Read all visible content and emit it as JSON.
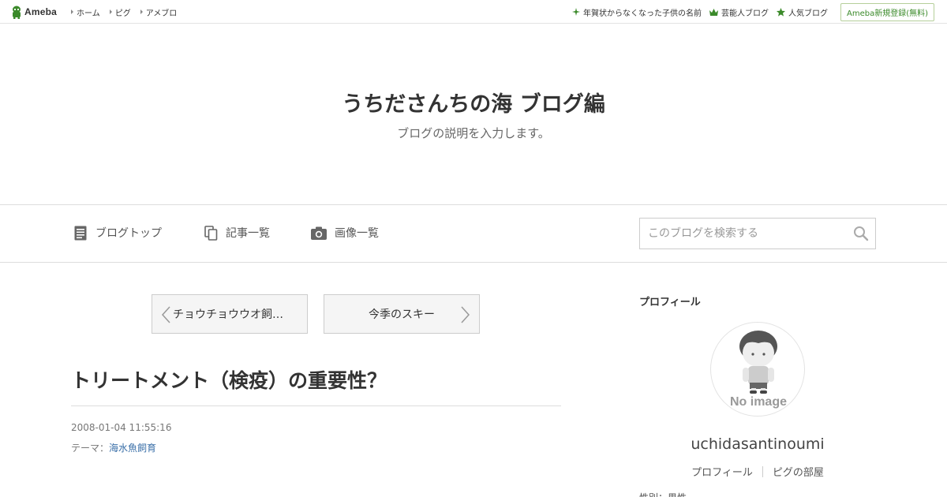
{
  "topbar": {
    "logo_text": "Ameba",
    "nav": [
      {
        "label": "ホーム"
      },
      {
        "label": "ピグ"
      },
      {
        "label": "アメブロ"
      }
    ],
    "right": [
      {
        "label": "年賀状からなくなった子供の名前",
        "icon": "sparkle-icon"
      },
      {
        "label": "芸能人ブログ",
        "icon": "crown-icon"
      },
      {
        "label": "人気ブログ",
        "icon": "star-icon"
      }
    ],
    "register_label": "Ameba新規登録(無料)",
    "accent_color": "#3b8a2a"
  },
  "header": {
    "title": "うちださんちの海 ブログ編",
    "description": "ブログの説明を入力します。"
  },
  "navbar": {
    "items": [
      {
        "label": "ブログトップ",
        "icon": "document-icon"
      },
      {
        "label": "記事一覧",
        "icon": "copy-icon"
      },
      {
        "label": "画像一覧",
        "icon": "camera-icon"
      }
    ],
    "search_placeholder": "このブログを検索する"
  },
  "pager": {
    "prev_label": "チョウチョウウオ飼…",
    "next_label": "今季のスキー"
  },
  "article": {
    "title": "トリートメント（検疫）の重要性？",
    "date": "2008-01-04 11:55:16",
    "theme_prefix": "テーマ：",
    "theme_link": "海水魚飼育",
    "link_color": "#3a6fa8"
  },
  "sidebar": {
    "heading": "プロフィール",
    "avatar_caption": "No image",
    "username": "uchidasantinoumi",
    "links": [
      "プロフィール",
      "ピグの部屋"
    ],
    "cut_text": "性別：男性"
  }
}
